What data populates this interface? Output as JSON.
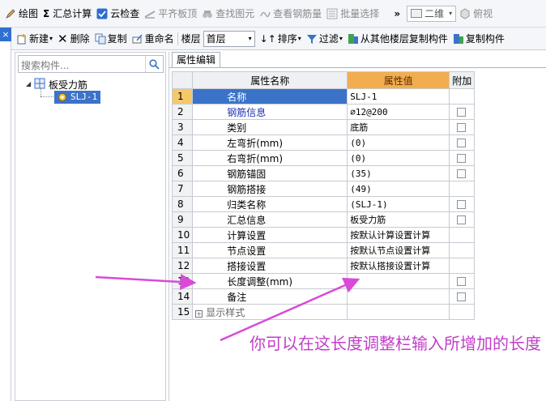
{
  "toolbar1": {
    "draw": "绘图",
    "sum_calc": "汇总计算",
    "cloud_check": "云检查",
    "align_slab": "平齐板顶",
    "find_element": "查找图元",
    "view_rebar": "查看钢筋量",
    "batch_select": "批量选择",
    "overflow": "»",
    "view_mode": "二维",
    "view_dir": "俯视"
  },
  "toolbar2": {
    "new": "新建",
    "delete": "删除",
    "copy": "复制",
    "rename": "重命名",
    "floor_label": "楼层",
    "floor_value": "首层",
    "sort": "排序",
    "filter": "过滤",
    "copy_from_floor": "从其他楼层复制构件",
    "copy_to": "复制构件"
  },
  "left_panel": {
    "close": "×",
    "search_placeholder": "搜索构件...",
    "tree_root": "板受力筋",
    "tree_child": "SLJ-1"
  },
  "right_panel": {
    "tab": "属性编辑",
    "columns": [
      "属性名称",
      "属性值",
      "附加"
    ],
    "rows": [
      {
        "no": "1",
        "name": "名称",
        "value": "SLJ-1",
        "checkbox": false
      },
      {
        "no": "2",
        "name": "钢筋信息",
        "value": "⌀12@200",
        "checkbox": true
      },
      {
        "no": "3",
        "name": "类别",
        "value": "底筋",
        "checkbox": true
      },
      {
        "no": "4",
        "name": "左弯折(mm)",
        "value": "(0)",
        "checkbox": true
      },
      {
        "no": "5",
        "name": "右弯折(mm)",
        "value": "(0)",
        "checkbox": true
      },
      {
        "no": "6",
        "name": "钢筋锚固",
        "value": "(35)",
        "checkbox": true
      },
      {
        "no": "7",
        "name": "钢筋搭接",
        "value": "(49)",
        "checkbox": false
      },
      {
        "no": "8",
        "name": "归类名称",
        "value": "(SLJ-1)",
        "checkbox": true
      },
      {
        "no": "9",
        "name": "汇总信息",
        "value": "板受力筋",
        "checkbox": true
      },
      {
        "no": "10",
        "name": "计算设置",
        "value": "按默认计算设置计算",
        "checkbox": false
      },
      {
        "no": "11",
        "name": "节点设置",
        "value": "按默认节点设置计算",
        "checkbox": false
      },
      {
        "no": "12",
        "name": "搭接设置",
        "value": "按默认搭接设置计算",
        "checkbox": false
      },
      {
        "no": "13",
        "name": "长度调整(mm)",
        "value": "",
        "checkbox": true
      },
      {
        "no": "14",
        "name": "备注",
        "value": "",
        "checkbox": true
      },
      {
        "no": "15",
        "name": "显示样式",
        "value": "",
        "checkbox": false
      }
    ]
  },
  "annotation": "你可以在这长度调整栏输入所增加的长度",
  "colors": {
    "annotation": "#c03fc8",
    "selection": "#3a73c8",
    "value_header": "#f2ad4f"
  }
}
